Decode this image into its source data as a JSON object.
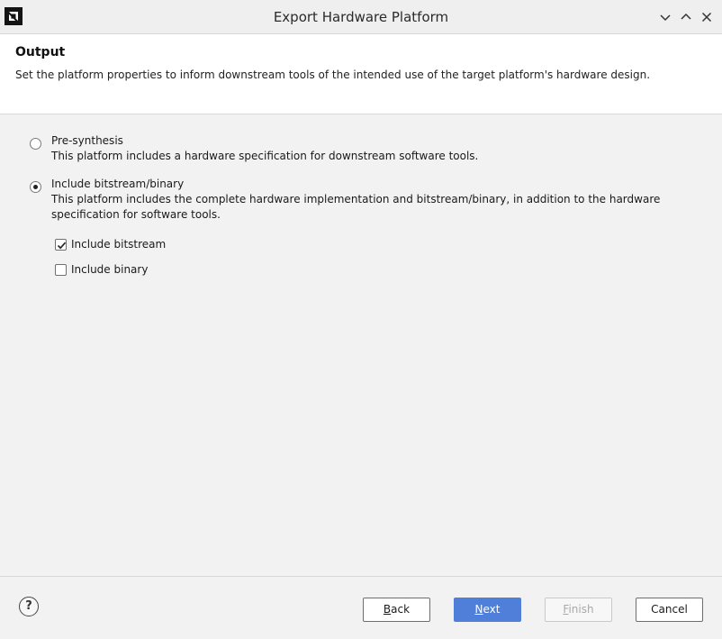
{
  "window": {
    "title": "Export Hardware Platform"
  },
  "header": {
    "title": "Output",
    "description": "Set the platform properties to inform downstream tools of the intended use of the target platform's hardware design."
  },
  "options": {
    "presynth": {
      "label": "Pre-synthesis",
      "description": "This platform includes a hardware specification for downstream software tools.",
      "selected": false
    },
    "bitstream": {
      "label": "Include bitstream/binary",
      "description": "This platform includes the complete hardware implementation and bitstream/binary, in addition to the hardware specification for software tools.",
      "selected": true
    }
  },
  "checkboxes": {
    "include_bitstream": {
      "label": "Include bitstream",
      "checked": true
    },
    "include_binary": {
      "label": "Include binary",
      "checked": false
    }
  },
  "footer": {
    "help_label": "?",
    "back": {
      "mnemonic": "B",
      "rest": "ack"
    },
    "next": {
      "mnemonic": "N",
      "rest": "ext"
    },
    "finish": {
      "mnemonic": "F",
      "rest": "inish",
      "enabled": false
    },
    "cancel": {
      "label": "Cancel"
    }
  },
  "colors": {
    "accent": "#4f7fd9",
    "background": "#f2f2f2",
    "header_background": "#ffffff"
  },
  "icons": {
    "app": "amd-logo-icon",
    "minimize": "chevron-down-icon",
    "maximize": "chevron-up-icon",
    "close": "close-icon",
    "help": "help-icon"
  }
}
